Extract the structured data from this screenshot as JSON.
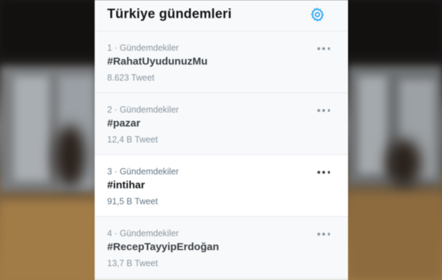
{
  "panel": {
    "title": "Türkiye gündemleri",
    "settings_icon": "gear-icon",
    "accent_color": "#1da1f2"
  },
  "trends": [
    {
      "meta": "1 · Gündemdekiler",
      "tag": "#RahatUyudunuzMu",
      "count": "8.623 Tweet",
      "more_icon": "more-dots-icon"
    },
    {
      "meta": "2 · Gündemdekiler",
      "tag": "#pazar",
      "count": "12,4 B Tweet",
      "more_icon": "more-dots-icon"
    },
    {
      "meta": "3 · Gündemdekiler",
      "tag": "#intihar",
      "count": "91,5 B Tweet",
      "more_icon": "more-dots-icon"
    },
    {
      "meta": "4 · Gündemdekiler",
      "tag": "#RecepTayyipErdoğan",
      "count": "13,7 B Tweet",
      "more_icon": "more-dots-icon"
    }
  ]
}
